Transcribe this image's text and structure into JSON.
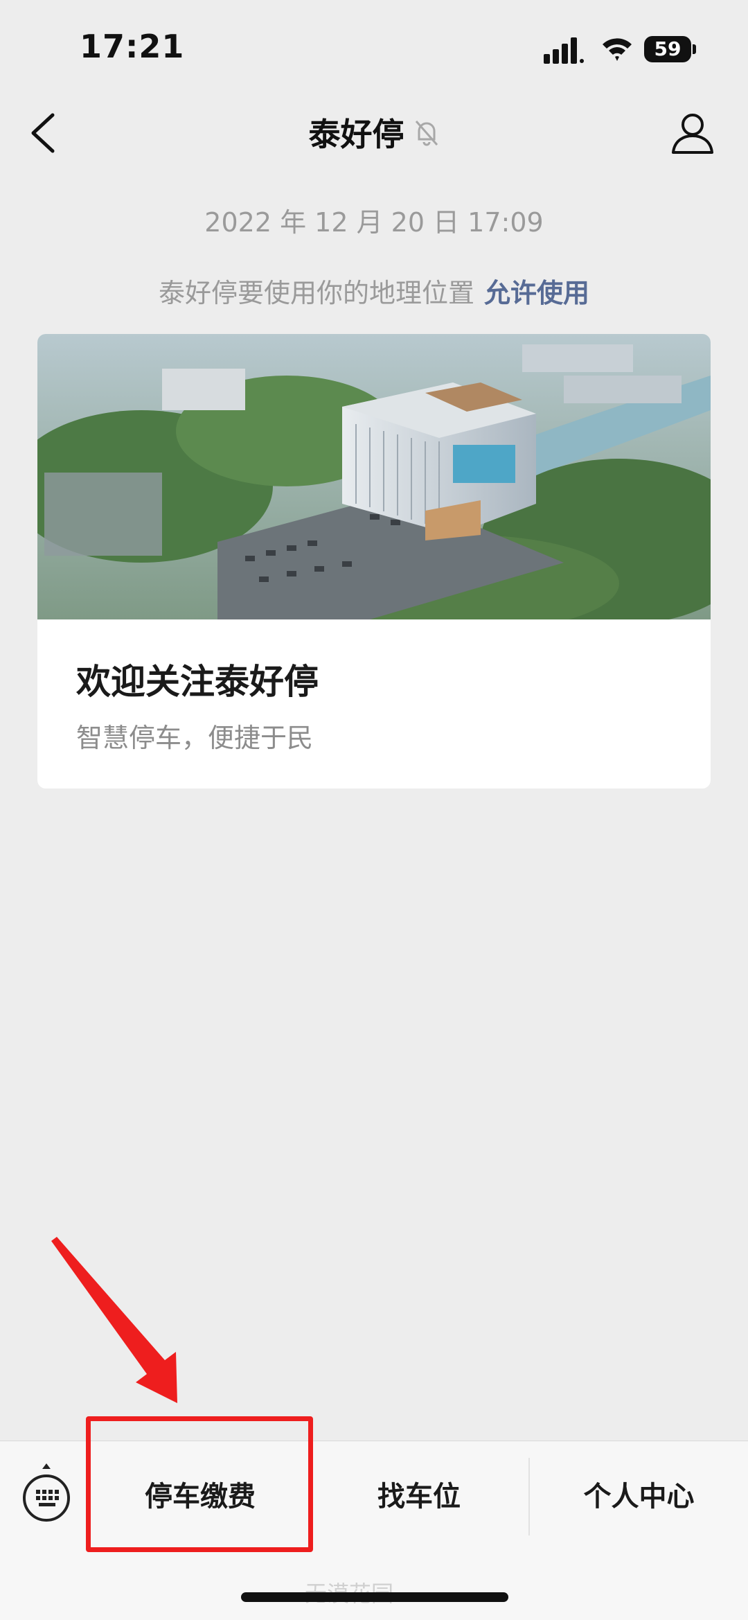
{
  "status_bar": {
    "time": "17:21",
    "battery": "59"
  },
  "nav": {
    "title": "泰好停",
    "back_icon": "chevron-left-icon",
    "mute_icon": "bell-off-icon",
    "profile_icon": "person-icon"
  },
  "chat": {
    "timestamp": "2022 年 12 月 20 日 17:09",
    "location_notice": "泰好停要使用你的地理位置",
    "location_allow": "允许使用"
  },
  "article": {
    "title": "欢迎关注泰好停",
    "description": "智慧停车，便捷于民"
  },
  "menu": {
    "keyboard_icon": "keyboard-icon",
    "items": [
      {
        "label": "停车缴费"
      },
      {
        "label": "找车位"
      },
      {
        "label": "个人中心"
      }
    ]
  },
  "annotation": {
    "color": "#ee1e1e"
  },
  "watermark": "无漠花园",
  "colors": {
    "link": "#576b95",
    "background": "#ededed",
    "highlight": "#ee1e1e"
  }
}
